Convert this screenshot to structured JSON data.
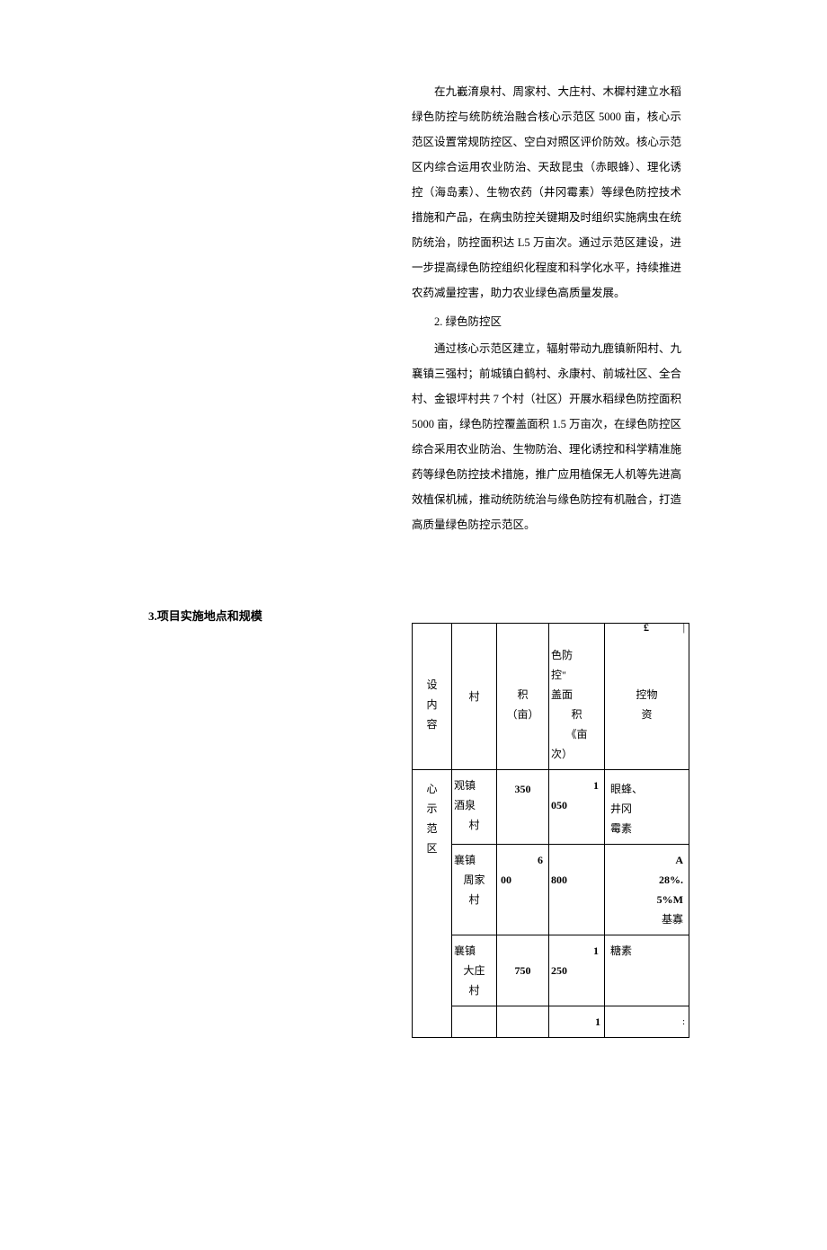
{
  "paragraph1": "在九嶻淯泉村、周家村、大庄村、木樨村建立水稻绿色防控与统防统治融合核心示范区 5000 亩，核心示范区设置常规防控区、空白对照区评价防效。核心示范区内综合运用农业防治、天敌昆虫（赤眼蜂）、理化诱控（海岛素）、生物农药（井冈霉素）等绿色防控技术措施和产品，在病虫防控关键期及时组织实施病虫在统防统治，防控面积达 L5 万亩次。通过示范区建设，进一步提高绿色防控组织化程度和科学化水平，持续推进农药减量控害，助力农业绿色高质量发展。",
  "heading2": "2. 绿色防控区",
  "paragraph2": "通过核心示范区建立，辐射带动九鹿镇新阳村、九襄镇三强村；前城镇白鹤村、永康村、前城社区、全合村、金银坪村共 7 个村（社区）开展水稻绿色防控面积 5000 亩，绿色防控覆盖面积 1.5 万亩次，在绿色防控区综合采用农业防治、生物防治、理化诱控和科学精准施药等绿色防控技术措施，推广应用植保无人机等先进高效植保机械，推动统防统治与缘色防控有机融合，打造高质量绿色防控示范区。",
  "leftHeading": "3.项目实施地点和规模",
  "marks": {
    "pound": "£",
    "bar": "|"
  },
  "table": {
    "head": {
      "c1a": "设",
      "c1b": "内",
      "c1c": "容",
      "c2": "村",
      "c3a": "积",
      "c3b": "（亩）",
      "c4a": "色防",
      "c4b": "控\"",
      "c4c": "盖面",
      "c4d": "积",
      "c4e": "《亩",
      "c4f": "次）",
      "c5a": "控物",
      "c5b": "资"
    },
    "rows": [
      {
        "c1a": "心",
        "c1b": "示",
        "c1c": "范",
        "c1d": "区",
        "c2a": "观镇",
        "c2b": "酒泉",
        "c2c": "村",
        "c3": "350",
        "c4top": "1",
        "c4": "050",
        "c5a": "眼蜂、",
        "c5b": "井冈",
        "c5c": "霉素"
      },
      {
        "c2a": "襄镇",
        "c2b": "周家",
        "c2c": "村",
        "c3top": "6",
        "c3": "00",
        "c4": "800",
        "c5a": "A",
        "c5b": "28%.",
        "c5c": "5%M",
        "c5d": "基寡"
      },
      {
        "c2a": "襄镇",
        "c2b": "大庄",
        "c2c": "村",
        "c3": "750",
        "c4top": "1",
        "c4": "250",
        "c5": "糖素"
      },
      {
        "c4top": "1"
      }
    ]
  }
}
